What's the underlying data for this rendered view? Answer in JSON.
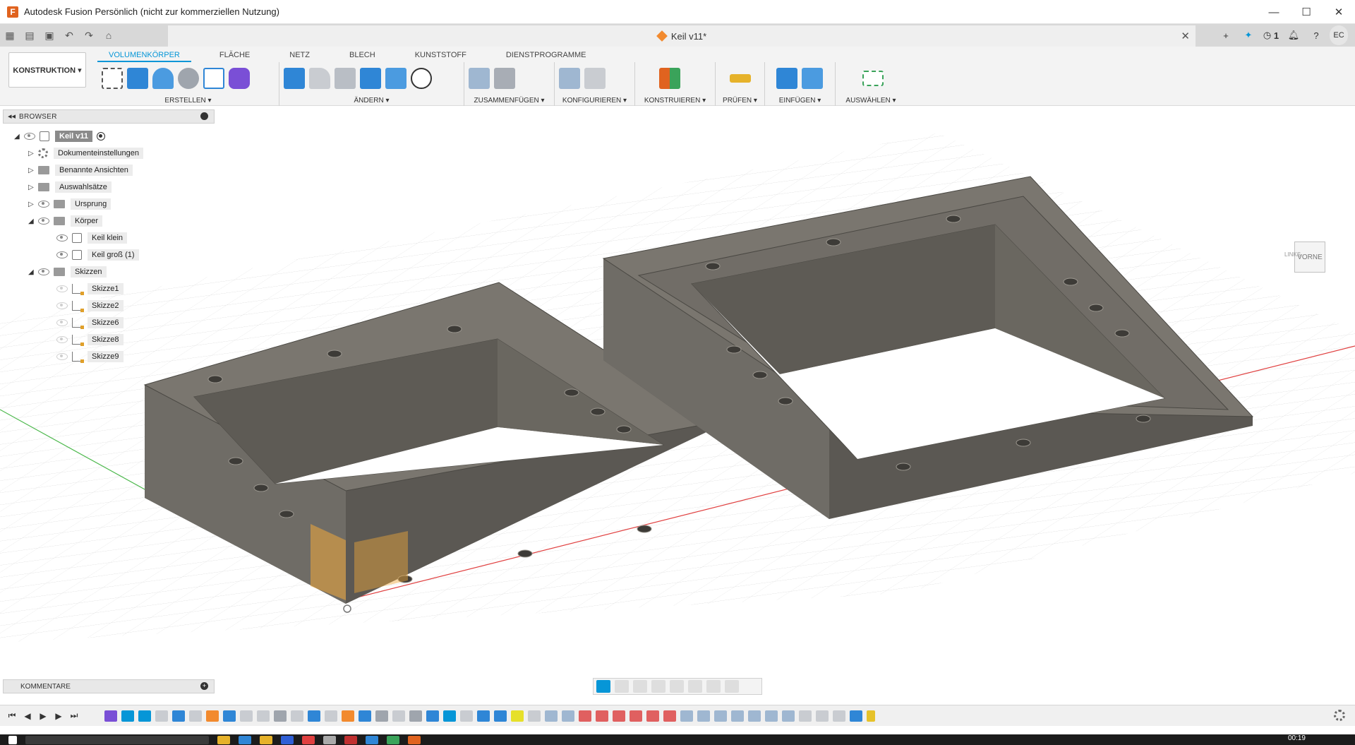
{
  "window": {
    "title": "Autodesk Fusion Persönlich (nicht zur kommerziellen Nutzung)",
    "minimize": "—",
    "maximize": "☐",
    "close": "✕"
  },
  "tabbar": {
    "doc_title": "Keil v11*",
    "close": "✕",
    "job_count": "1",
    "user_initials": "EC"
  },
  "ribbon": {
    "workspace": "KONSTRUKTION ▾",
    "tabs": [
      "VOLUMENKÖRPER",
      "FLÄCHE",
      "NETZ",
      "BLECH",
      "KUNSTSTOFF",
      "DIENSTPROGRAMME"
    ],
    "groups": [
      "ERSTELLEN ▾",
      "ÄNDERN ▾",
      "ZUSAMMENFÜGEN ▾",
      "KONFIGURIEREN ▾",
      "KONSTRUIEREN ▾",
      "PRÜFEN ▾",
      "EINFÜGEN ▾",
      "AUSWÄHLEN ▾"
    ]
  },
  "browser": {
    "title": "BROWSER",
    "root": "Keil v11",
    "items": [
      "Dokumenteinstellungen",
      "Benannte Ansichten",
      "Auswahlsätze",
      "Ursprung",
      "Körper",
      "Keil klein",
      "Keil groß (1)",
      "Skizzen",
      "Skizze1",
      "Skizze2",
      "Skizze6",
      "Skizze8",
      "Skizze9"
    ]
  },
  "viewcube": {
    "front": "VORNE",
    "left": "LINKS"
  },
  "comments": {
    "title": "KOMMENTARE"
  },
  "taskbar": {
    "clock": "00:19"
  },
  "colors": {
    "accent": "#0696d7",
    "model": "#6d6a63",
    "model_top": "#7b776f",
    "inner": "#5e5b55"
  }
}
